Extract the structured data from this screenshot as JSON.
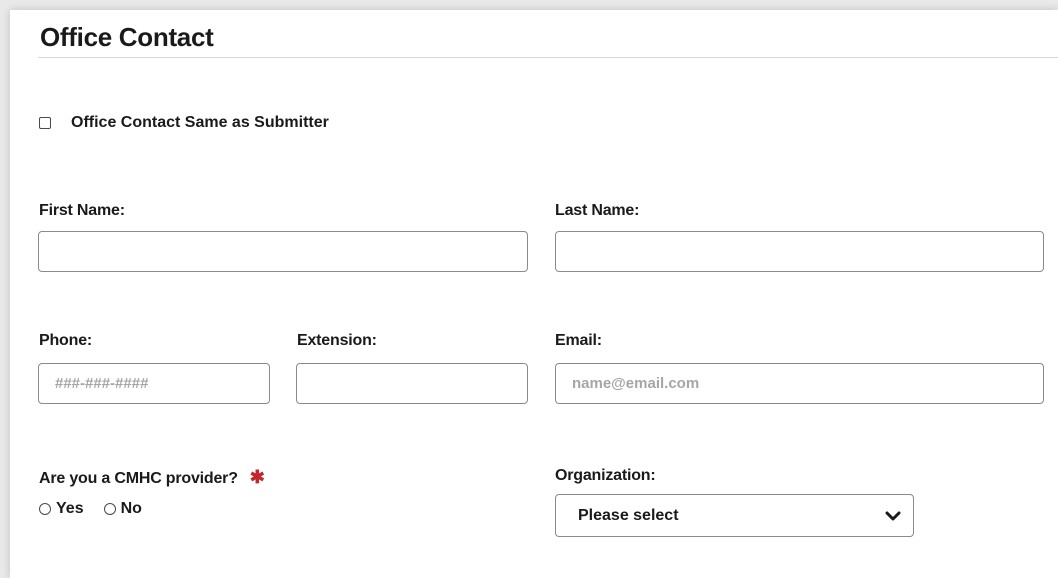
{
  "section": {
    "title": "Office Contact"
  },
  "same_as_submitter": {
    "label": "Office Contact Same as Submitter",
    "checked": false
  },
  "first_name": {
    "label": "First Name:",
    "value": "",
    "placeholder": ""
  },
  "last_name": {
    "label": "Last Name:",
    "value": "",
    "placeholder": ""
  },
  "phone": {
    "label": "Phone:",
    "value": "",
    "placeholder": "###-###-####"
  },
  "extension": {
    "label": "Extension:",
    "value": "",
    "placeholder": ""
  },
  "email": {
    "label": "Email:",
    "value": "",
    "placeholder": "name@email.com"
  },
  "cmhc_provider": {
    "label": "Are you a CMHC provider?",
    "required_mark": "✱",
    "options": [
      "Yes",
      "No"
    ],
    "selected": null
  },
  "organization": {
    "label": "Organization:",
    "selected": "Please select"
  },
  "colors": {
    "required": "#c0282d",
    "border": "#8a8a8a",
    "placeholder": "#a6a6a6"
  }
}
